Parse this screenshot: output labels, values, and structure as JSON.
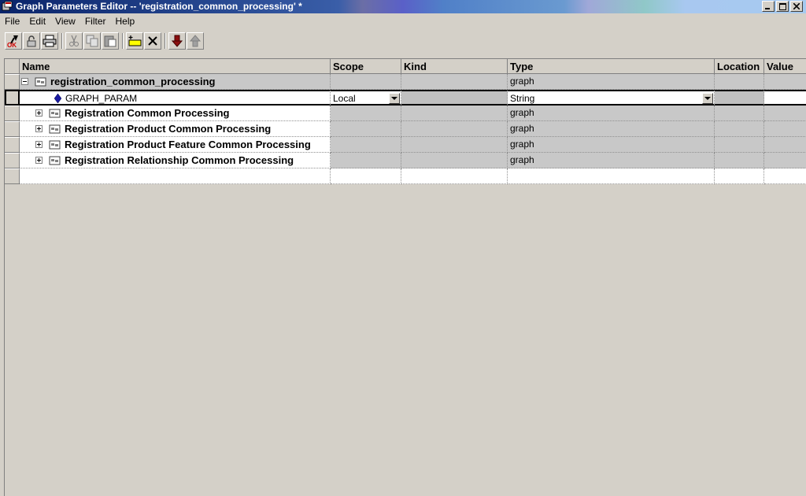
{
  "window": {
    "title": "Graph Parameters Editor -- 'registration_common_processing' *",
    "buttons": [
      "minimize",
      "maximize",
      "close"
    ]
  },
  "menu": [
    "File",
    "Edit",
    "View",
    "Filter",
    "Help"
  ],
  "toolbar": {
    "icons": [
      "ok-icon",
      "lock-icon",
      "print-icon",
      "cut-icon",
      "copy-icon",
      "paste-icon",
      "new-parameter-icon",
      "delete-icon",
      "move-down-icon",
      "move-up-icon"
    ]
  },
  "grid": {
    "columns": [
      "Name",
      "Scope",
      "Kind",
      "Type",
      "Location",
      "Value"
    ],
    "root": {
      "name": "registration_common_processing",
      "type": "graph"
    },
    "param": {
      "name": "GRAPH_PARAM",
      "scope": "Local",
      "type": "String"
    },
    "subgraphs": [
      {
        "name": "Registration Common Processing",
        "type": "graph"
      },
      {
        "name": "Registration Product Common Processing",
        "type": "graph"
      },
      {
        "name": "Registration Product Feature Common Processing",
        "type": "graph"
      },
      {
        "name": "Registration Relationship Common Processing",
        "type": "graph"
      }
    ]
  }
}
